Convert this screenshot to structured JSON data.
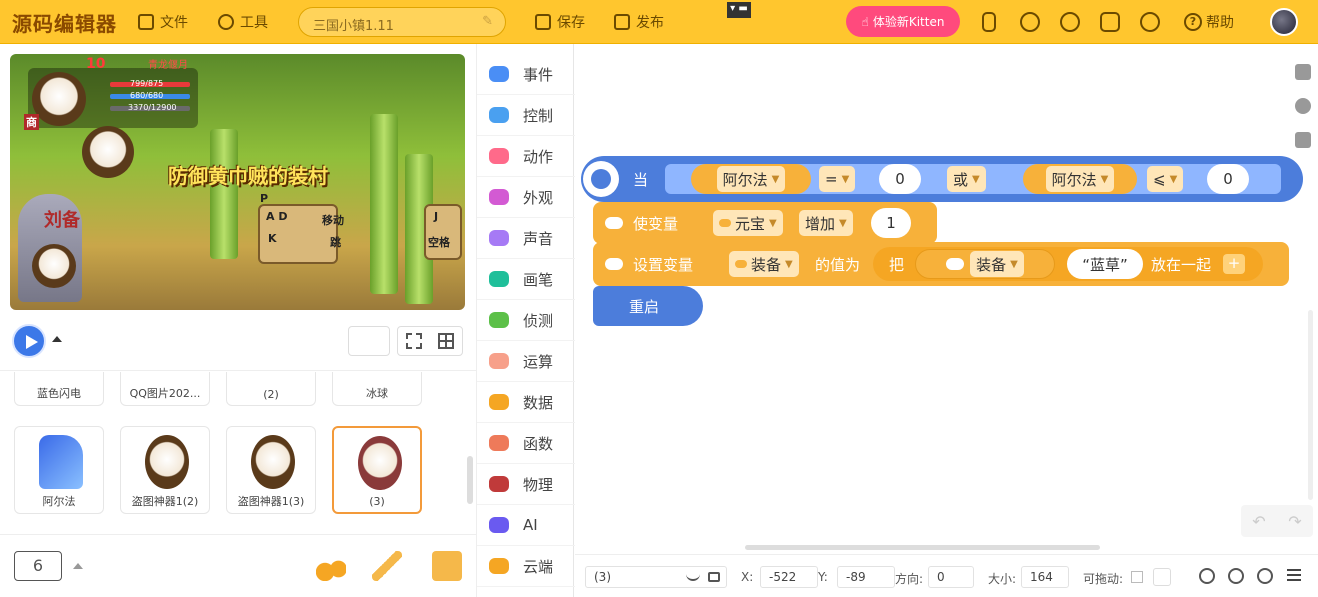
{
  "app": {
    "logo": "源码编辑器",
    "menu": {
      "file": "文件",
      "tools": "工具",
      "save": "保存",
      "publish": "发布",
      "help": "帮助"
    },
    "project_name": "三国小镇1.11",
    "kitten_button": "体验新Kitten",
    "collapse_label": "▾ ▬",
    "accent": "#ffc62e",
    "kitten_color": "#ff4a7d"
  },
  "stage": {
    "title": "防御黄巾贼的装村",
    "level": "10",
    "banner": "青龙偃月",
    "hud": {
      "hp": "799/875",
      "mp": "680/680",
      "exp": "3370/12900"
    },
    "shop_label": "商",
    "keys": {
      "ad": "A D",
      "move": "移动",
      "k": "K",
      "jump": "跳",
      "j": "J",
      "space": "空格",
      "p": "P"
    },
    "rock_text": "刘备"
  },
  "controls": {
    "play_label": "play",
    "page_number": "6"
  },
  "sprites": [
    {
      "name": "蓝色闪电",
      "partial": true
    },
    {
      "name": "QQ图片202...",
      "partial": true
    },
    {
      "name": "(2)",
      "partial": true
    },
    {
      "name": "冰球",
      "partial": true
    },
    {
      "name": "阿尔法",
      "selected": false
    },
    {
      "name": "盗图神器1(2)",
      "selected": false
    },
    {
      "name": "盗图神器1(3)",
      "selected": false
    },
    {
      "name": "(3)",
      "selected": true
    }
  ],
  "categories": [
    {
      "label": "事件",
      "color": "#4a8ef5"
    },
    {
      "label": "控制",
      "color": "#4aa0f0"
    },
    {
      "label": "动作",
      "color": "#ff6a8a"
    },
    {
      "label": "外观",
      "color": "#d35ad3"
    },
    {
      "label": "声音",
      "color": "#a67af5"
    },
    {
      "label": "画笔",
      "color": "#1fbf9a"
    },
    {
      "label": "侦测",
      "color": "#5cc048"
    },
    {
      "label": "运算",
      "color": "#f7a08a"
    },
    {
      "label": "数据",
      "color": "#f5a623"
    },
    {
      "label": "函数",
      "color": "#ee7a5a"
    },
    {
      "label": "物理",
      "color": "#c03a3a"
    },
    {
      "label": "AI",
      "color": "#6a5af0"
    },
    {
      "label": "云端",
      "color": "#f5a623"
    }
  ],
  "workspace": {
    "when_block": {
      "label": "当",
      "var1": "阿尔法",
      "op1": "=",
      "val1": "0",
      "or": "或",
      "var2": "阿尔法",
      "op2": "⩽",
      "val2": "0",
      "color": "#4c7ddb"
    },
    "change_block": {
      "label": "使变量",
      "var": "元宝",
      "op": "增加",
      "value": "1",
      "color": "#f7b13a"
    },
    "set_block": {
      "label": "设置变量",
      "var": "装备",
      "to": "的值为",
      "join_prefix": "把",
      "join_var": "装备",
      "join_text": "“蓝草”",
      "join_suffix": "放在一起",
      "plus": "+"
    },
    "restart_block": {
      "label": "重启",
      "color": "#4c7ddb"
    }
  },
  "status": {
    "sprite_name": "(3)",
    "x_label": "X:",
    "x": "-522",
    "y_label": "Y:",
    "y": "-89",
    "dir_label": "方向:",
    "dir": "0",
    "size_label": "大小:",
    "size": "164",
    "drag_label": "可拖动:"
  },
  "undo_redo": {
    "undo": "↶",
    "redo": "↷"
  }
}
